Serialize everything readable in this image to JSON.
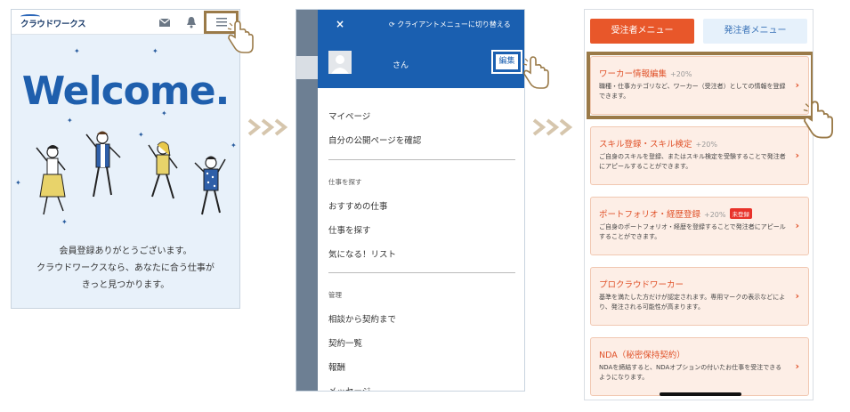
{
  "screen1": {
    "logo": "クラウドワークス",
    "welcome": "Welcome.",
    "message_lines": [
      "会員登録ありがとうございます。",
      "クラウドワークスなら、あなたに合う仕事が",
      "きっと見つかります。"
    ],
    "header_icons": [
      "mail-icon",
      "bell-icon",
      "hamburger-menu-icon"
    ]
  },
  "screen2": {
    "close": "×",
    "switch_label": "クライアントメニューに切り替える",
    "user_name": "さん",
    "edit_label": "編集",
    "items_group1": [
      "マイページ",
      "自分の公開ページを確認"
    ],
    "section_jobs": "仕事を探す",
    "items_group2": [
      "おすすめの仕事",
      "仕事を探す",
      "気になる！リスト"
    ],
    "section_manage": "管理",
    "items_group3": [
      "相談から契約まで",
      "契約一覧",
      "報酬",
      "メッセージ"
    ]
  },
  "screen3": {
    "tab_active": "受注者メニュー",
    "tab_inactive": "発注者メニュー",
    "cards": [
      {
        "title": "ワーカー情報編集",
        "percent": "+20%",
        "desc": "職種・仕事カテゴリなど、ワーカー（受注者）としての情報を登録できます。"
      },
      {
        "title": "スキル登録・スキル検定",
        "percent": "+20%",
        "desc": "ご自身のスキルを登録、またはスキル検定を受験することで発注者にアピールすることができます。"
      },
      {
        "title": "ポートフォリオ・経歴登録",
        "percent": "+20%",
        "badge": "未登録",
        "desc": "ご自身のポートフォリオ・経歴を登録することで発注者にアピールすることができます。"
      },
      {
        "title": "プロクラウドワーカー",
        "percent": "",
        "desc": "基準を満たした方だけが認定されます。専用マークの表示などにより、発注される可能性が高まります。"
      },
      {
        "title": "NDA（秘密保持契約）",
        "percent": "",
        "desc": "NDAを締結すると、NDAオプションの付いたお仕事を受注できるようになります。"
      }
    ]
  },
  "colors": {
    "welcome_blue": "#1f5fad",
    "drawer_blue": "#1a5fb0",
    "accent_orange": "#e8572a",
    "highlight_brown": "#9a7a48",
    "card_bg": "#fdeee6"
  }
}
